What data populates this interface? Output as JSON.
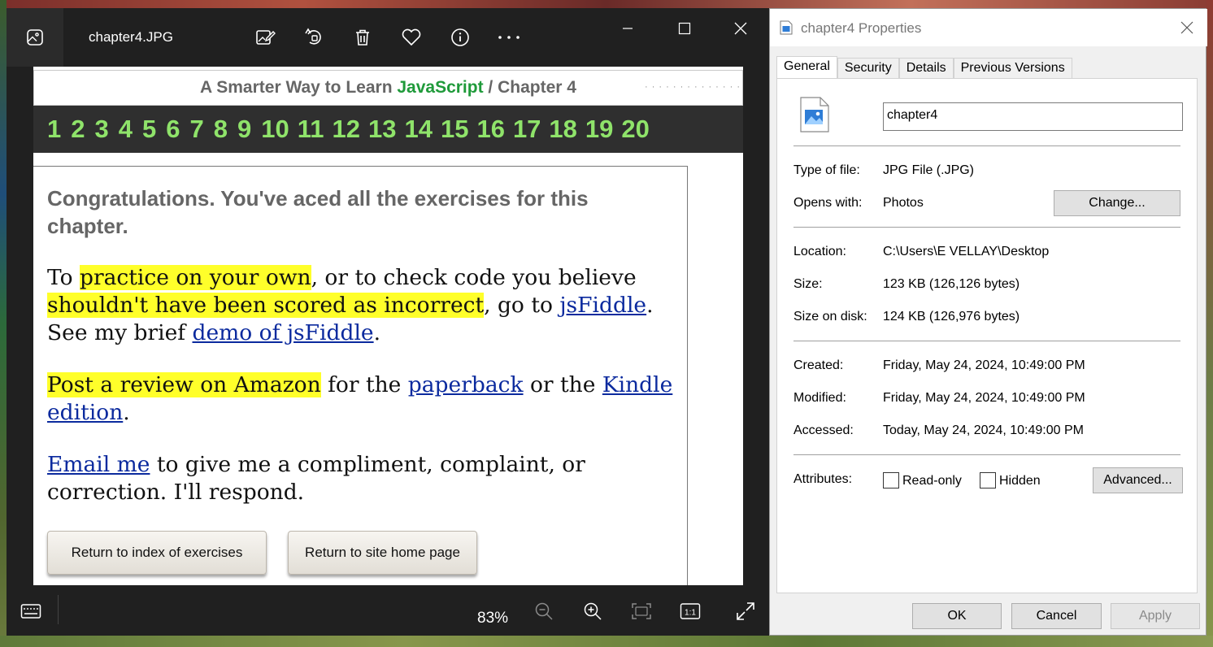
{
  "photos": {
    "filename": "chapter4.JPG",
    "toolbar_icons": [
      "edit-image-icon",
      "rotate-icon",
      "delete-icon",
      "favorite-icon",
      "info-icon",
      "more-icon"
    ],
    "window_controls": [
      "minimize",
      "maximize",
      "close"
    ],
    "zoom": "83%",
    "image": {
      "header_prefix": "A Smarter Way to Learn ",
      "header_js": "JavaScript",
      "header_suffix": " / Chapter 4",
      "chapters": [
        "1",
        "2",
        "3",
        "4",
        "5",
        "6",
        "7",
        "8",
        "9",
        "10",
        "11",
        "12",
        "13",
        "14",
        "15",
        "16",
        "17",
        "18",
        "19",
        "20"
      ],
      "congrats": "Congratulations. You've aced all the exercises for this chapter.",
      "p1_a": "To ",
      "p1_hl1": "practice on your own",
      "p1_b": ", or to check code you believe ",
      "p1_hl2": "shouldn't have been scored as incorrect",
      "p1_c": ", go to ",
      "p1_link1": "jsFiddle",
      "p1_d": ". See my brief ",
      "p1_link2": "demo of jsFiddle",
      "p1_e": ".",
      "p2_hl": "Post a review on Amazon",
      "p2_a": " for the ",
      "p2_link1": "paperback",
      "p2_b": " or the ",
      "p2_link2": "Kindle edition",
      "p2_c": ".",
      "p3_link": "Email me",
      "p3_a": " to give me a compliment, complaint, or correction. I'll respond.",
      "btn1": "Return to index of exercises",
      "btn2": "Return to site home page"
    }
  },
  "properties": {
    "title": "chapter4 Properties",
    "tabs": [
      "General",
      "Security",
      "Details",
      "Previous Versions"
    ],
    "active_tab": "General",
    "name": "chapter4",
    "type_label": "Type of file:",
    "type_value": "JPG File (.JPG)",
    "opens_label": "Opens with:",
    "opens_value": "Photos",
    "change_btn": "Change...",
    "location_label": "Location:",
    "location_value": "C:\\Users\\E VELLAY\\Desktop",
    "size_label": "Size:",
    "size_value": "123 KB (126,126 bytes)",
    "size_disk_label": "Size on disk:",
    "size_disk_value": "124 KB (126,976 bytes)",
    "created_label": "Created:",
    "created_value": "Friday, May 24, 2024, 10:49:00 PM",
    "modified_label": "Modified:",
    "modified_value": "Friday, May 24, 2024, 10:49:00 PM",
    "accessed_label": "Accessed:",
    "accessed_value": "Today, May 24, 2024, 10:49:00 PM",
    "attributes_label": "Attributes:",
    "readonly_label": "Read-only",
    "hidden_label": "Hidden",
    "advanced_btn": "Advanced...",
    "ok_btn": "OK",
    "cancel_btn": "Cancel",
    "apply_btn": "Apply"
  }
}
